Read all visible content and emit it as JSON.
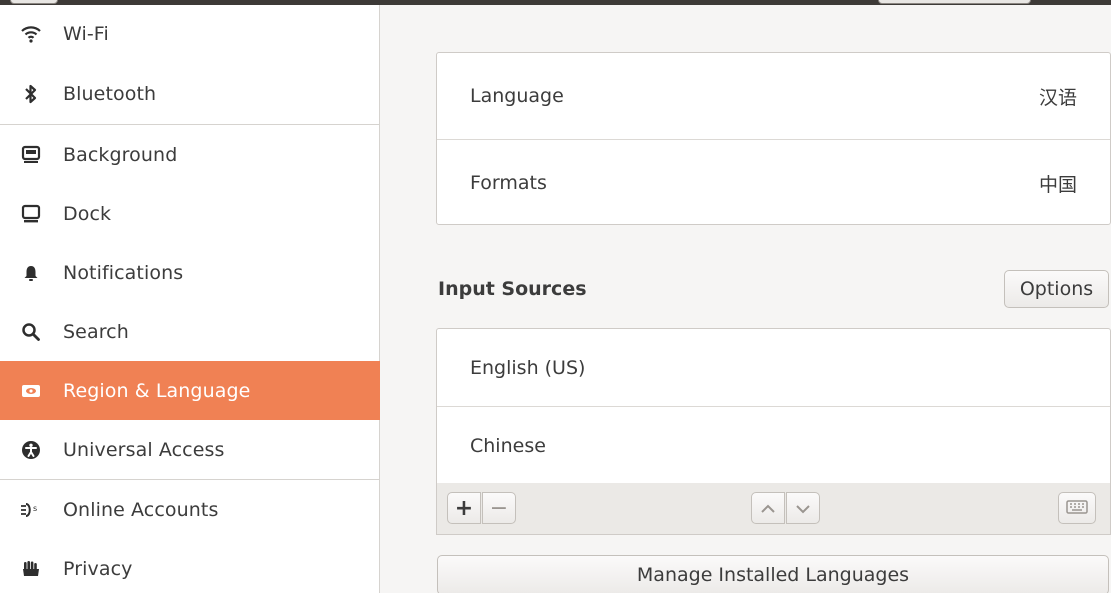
{
  "sidebar": {
    "items": [
      {
        "label": "Wi-Fi",
        "icon": "wifi-icon"
      },
      {
        "label": "Bluetooth",
        "icon": "bluetooth-icon"
      },
      {
        "label": "Background",
        "icon": "background-icon"
      },
      {
        "label": "Dock",
        "icon": "dock-icon"
      },
      {
        "label": "Notifications",
        "icon": "bell-icon"
      },
      {
        "label": "Search",
        "icon": "search-icon"
      },
      {
        "label": "Region & Language",
        "icon": "region-language-icon",
        "selected": true
      },
      {
        "label": "Universal Access",
        "icon": "universal-access-icon"
      },
      {
        "label": "Online Accounts",
        "icon": "online-accounts-icon"
      },
      {
        "label": "Privacy",
        "icon": "privacy-hand-icon"
      }
    ]
  },
  "region": {
    "language_label": "Language",
    "language_value": "汉语",
    "formats_label": "Formats",
    "formats_value": "中国"
  },
  "input_sources": {
    "title": "Input Sources",
    "options_label": "Options",
    "items": [
      "English (US)",
      "Chinese"
    ]
  },
  "toolbar": {
    "add_label": "+",
    "remove_label": "−"
  },
  "manage_label": "Manage Installed Languages",
  "colors": {
    "accent": "#f08154",
    "sidebar_bg": "#ffffff",
    "main_bg": "#f6f5f4"
  }
}
